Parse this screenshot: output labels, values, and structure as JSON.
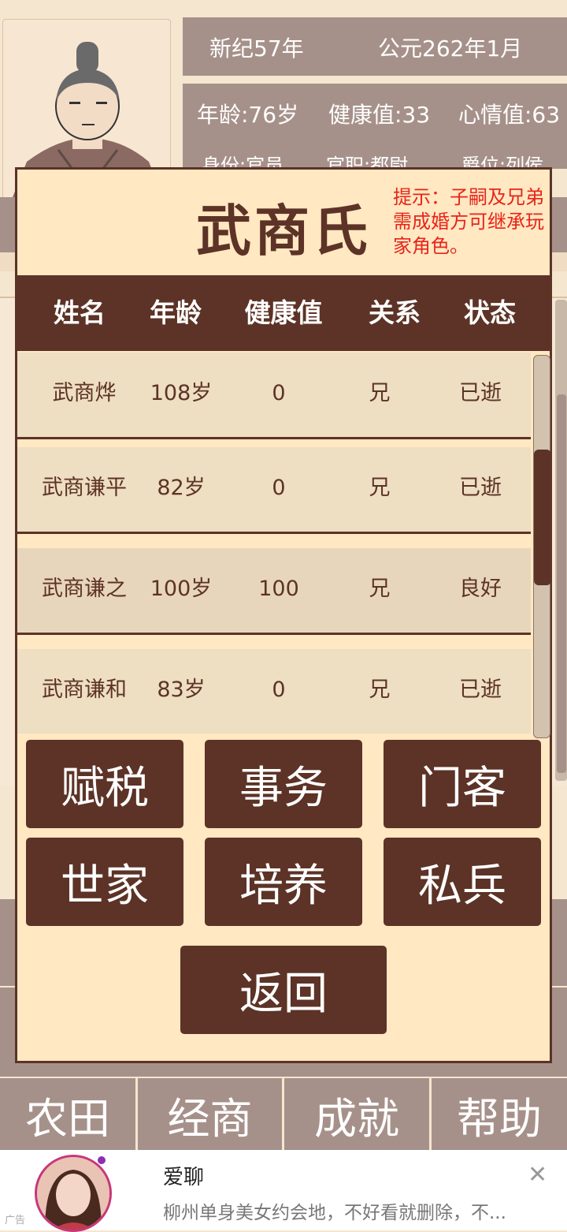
{
  "header": {
    "era": "新纪57年",
    "date": "公元262年1月",
    "age": "年龄:76岁",
    "health": "健康值:33",
    "mood": "心情值:63",
    "identity": "身份:官员",
    "office": "官职:都尉",
    "rank": "爵位:列侯"
  },
  "modal": {
    "title": "武商氏",
    "hint": "提示：子嗣及兄弟需成婚方可继承玩家角色。",
    "columns": [
      "姓名",
      "年龄",
      "健康值",
      "关系",
      "状态"
    ],
    "rows": [
      {
        "name": "武商烨",
        "age": "108岁",
        "health": "0",
        "relation": "兄",
        "status": "已逝"
      },
      {
        "name": "武商谦平",
        "age": "82岁",
        "health": "0",
        "relation": "兄",
        "status": "已逝"
      },
      {
        "name": "武商谦之",
        "age": "100岁",
        "health": "100",
        "relation": "兄",
        "status": "良好"
      },
      {
        "name": "武商谦和",
        "age": "83岁",
        "health": "0",
        "relation": "兄",
        "status": "已逝"
      }
    ],
    "buttons": [
      "赋税",
      "事务",
      "门客",
      "世家",
      "培养",
      "私兵"
    ],
    "back": "返回"
  },
  "nav": [
    "农田",
    "经商",
    "成就",
    "帮助"
  ],
  "ad": {
    "title": "爱聊",
    "description": "柳州单身美女约会地，不好看就删除，不...",
    "tag": "广告"
  },
  "colors": {
    "brown": "#5c3326",
    "panel": "#ffe8c2",
    "muted": "#a6918a",
    "hint": "#e8241a"
  }
}
